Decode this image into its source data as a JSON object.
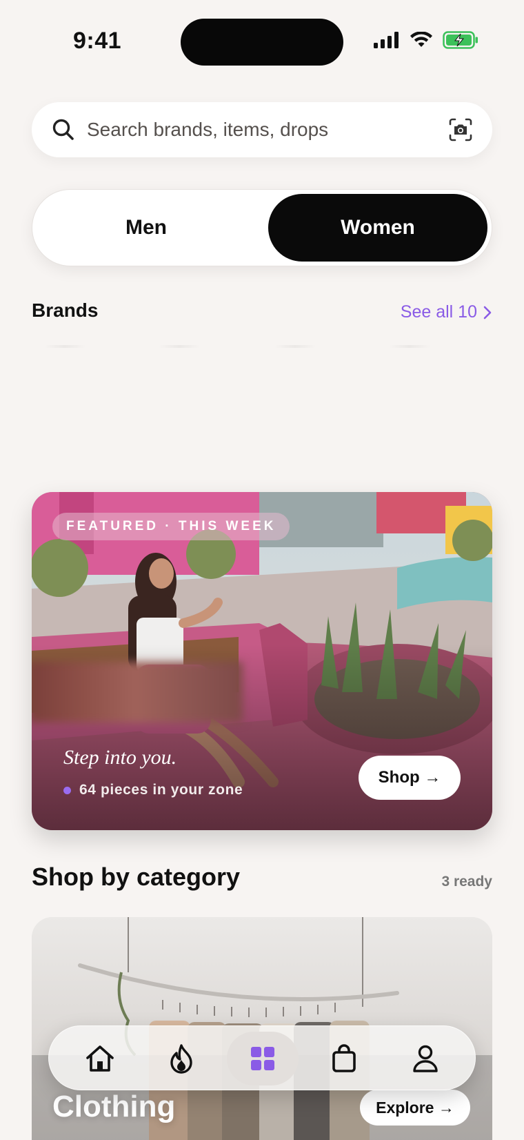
{
  "status_bar": {
    "time": "9:41"
  },
  "search": {
    "placeholder": "Search brands, items, drops"
  },
  "gender_toggle": {
    "options": [
      "Men",
      "Women"
    ],
    "selected": "Women"
  },
  "brands": {
    "title": "Brands",
    "see_all_label": "See all 10"
  },
  "featured": {
    "badge": "FEATURED · THIS WEEK",
    "tagline": "Step into you.",
    "meta": "64 pieces in your zone",
    "shop_label": "Shop →"
  },
  "categories": {
    "title": "Shop by category",
    "ready": "3 ready",
    "items": [
      {
        "name": "Clothing",
        "explore_label": "Explore →"
      }
    ]
  },
  "tab_bar": {
    "tabs": [
      {
        "icon": "home-icon"
      },
      {
        "icon": "flame-icon"
      },
      {
        "icon": "grid-icon",
        "active": true
      },
      {
        "icon": "bag-icon"
      },
      {
        "icon": "profile-icon"
      }
    ]
  },
  "colors": {
    "accent": "#8a5be6",
    "background": "#f7f4f2",
    "active_segment": "#0a0a0a"
  }
}
